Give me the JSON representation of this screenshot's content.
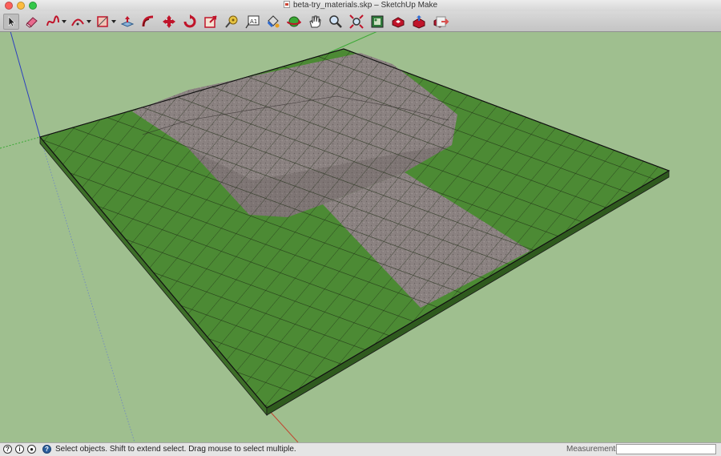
{
  "window": {
    "title": "beta-try_materials.skp – SketchUp Make"
  },
  "toolbar": {
    "tools": [
      {
        "name": "select-tool",
        "icon": "arrow-cursor-icon",
        "selected": true
      },
      {
        "name": "eraser-tool",
        "icon": "eraser-icon"
      },
      {
        "name": "freehand-tool",
        "icon": "freehand-curve-icon",
        "dropdown": true
      },
      {
        "name": "arc-tool",
        "icon": "arc-icon",
        "dropdown": true
      },
      {
        "name": "rectangle-tool",
        "icon": "rectangle-icon",
        "dropdown": true
      },
      {
        "name": "push-pull-tool",
        "icon": "push-pull-icon"
      },
      {
        "name": "follow-me-tool",
        "icon": "follow-me-icon"
      },
      {
        "name": "move-tool",
        "icon": "move-arrows-icon"
      },
      {
        "name": "rotate-tool",
        "icon": "rotate-icon"
      },
      {
        "name": "scale-tool",
        "icon": "scale-icon"
      },
      {
        "name": "tape-measure-tool",
        "icon": "tape-measure-icon"
      },
      {
        "name": "text-tool",
        "icon": "text-label-icon",
        "label": "A1"
      },
      {
        "name": "paint-bucket-tool",
        "icon": "paint-bucket-icon"
      },
      {
        "name": "orbit-tool",
        "icon": "orbit-icon"
      },
      {
        "name": "pan-tool",
        "icon": "hand-pan-icon"
      },
      {
        "name": "zoom-tool",
        "icon": "magnifier-icon"
      },
      {
        "name": "zoom-extents-tool",
        "icon": "zoom-extents-icon"
      },
      {
        "name": "photo-textures-tool",
        "icon": "photo-textures-icon"
      },
      {
        "name": "3d-warehouse-tool",
        "icon": "3d-warehouse-icon"
      },
      {
        "name": "share-model-tool",
        "icon": "share-model-icon"
      },
      {
        "name": "extension-warehouse-tool",
        "icon": "extension-warehouse-icon"
      },
      {
        "name": "send-to-layout-tool",
        "icon": "send-to-layout-icon"
      }
    ]
  },
  "viewport": {
    "colors": {
      "background": "#9fbf8f",
      "grass": "#4c8a34",
      "grass_side": "#3d6e28",
      "gravel": "#8b8281",
      "grid_lines": "#1a1a1a",
      "red_axis": "#c2452f",
      "green_axis": "#3aa834",
      "blue_axis": "#2c3fbf"
    }
  },
  "status": {
    "message": "Select objects. Shift to extend select. Drag mouse to select multiple.",
    "measurements_label": "Measurements",
    "measurements_value": ""
  }
}
